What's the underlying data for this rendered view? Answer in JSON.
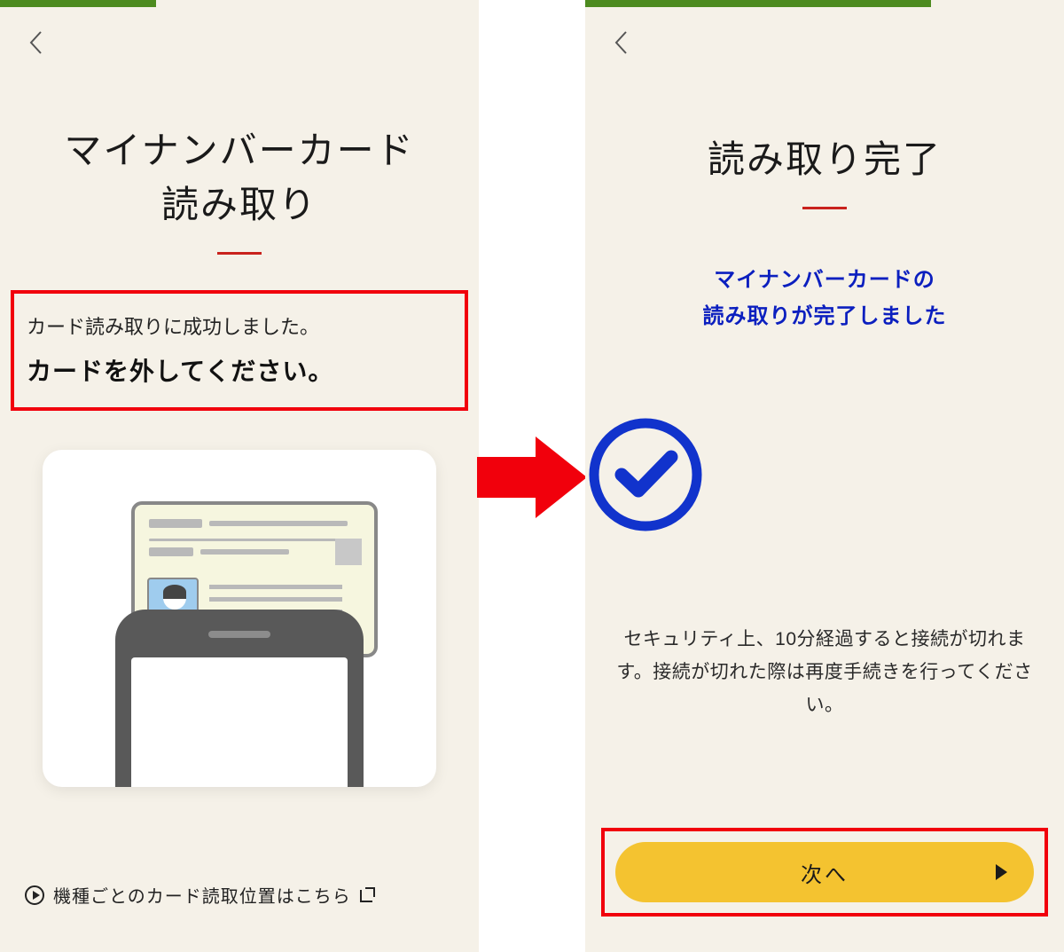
{
  "colors": {
    "accent_green": "#4d8b1f",
    "accent_red": "#c9221d",
    "highlight_red": "#f1000c",
    "button_yellow": "#f4c330",
    "link_blue": "#0b1fbf",
    "bg": "#f5f1e8"
  },
  "left_panel": {
    "title_line1": "マイナンバーカード",
    "title_line2": "読み取り",
    "message": {
      "line1": "カード読み取りに成功しました。",
      "line2": "カードを外してください。"
    },
    "device_link_text": "機種ごとのカード読取位置はこちら"
  },
  "right_panel": {
    "title": "読み取り完了",
    "success_msg_line1": "マイナンバーカードの",
    "success_msg_line2": "読み取りが完了しました",
    "security_text": "セキュリティ上、10分経過すると接続が切れます。接続が切れた際は再度手続きを行ってください。",
    "next_button_label": "次へ"
  }
}
